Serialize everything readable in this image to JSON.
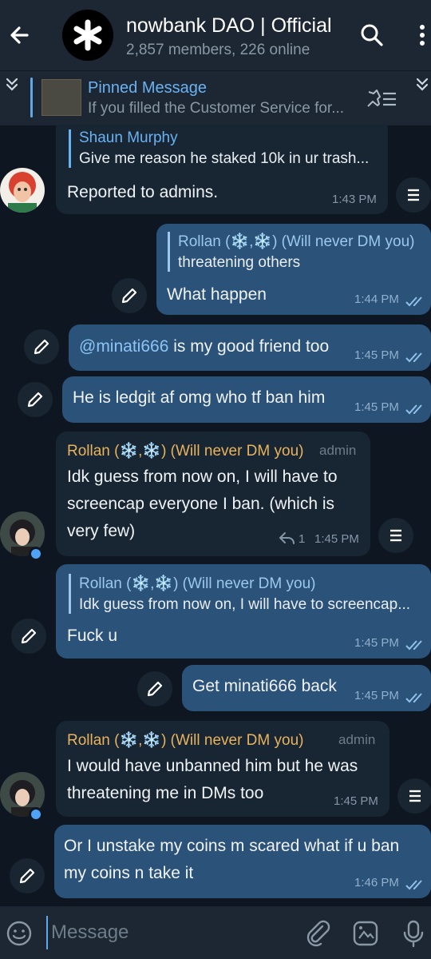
{
  "header": {
    "title": "nowbank DAO | Official",
    "subtitle": "2,857 members, 226 online"
  },
  "pinned": {
    "title": "Pinned Message",
    "text": "If you filled the Customer Service for..."
  },
  "messages": [
    {
      "reply_name": "Shaun Murphy",
      "reply_text": "Give me reason he staked 10k in ur trash...",
      "text": "Reported to admins.",
      "time": "1:43 PM"
    },
    {
      "reply_name": "Rollan (❄️,❄️) (Will never DM you)",
      "reply_text": "threatening others",
      "text": "What happen",
      "time": "1:44 PM"
    },
    {
      "mention": "@minati666",
      "text": " is my good friend too",
      "time": "1:45 PM"
    },
    {
      "text": "He is ledgit af omg who tf ban him",
      "time": "1:45 PM"
    },
    {
      "sender": "Rollan (❄️,❄️) (Will never DM you)",
      "role": "admin",
      "line1": "Idk guess from now on, I will have to",
      "line2": "screencap everyone I ban. (which is",
      "line3": "very few)",
      "reply_count": "1",
      "time": "1:45 PM"
    },
    {
      "reply_name": "Rollan (❄️,❄️) (Will never DM you)",
      "reply_text": "Idk guess from now on, I will have to screencap...",
      "text": "Fuck u",
      "time": "1:45 PM"
    },
    {
      "text": "Get minati666 back",
      "time": "1:45 PM"
    },
    {
      "sender": "Rollan (❄️,❄️) (Will never DM you)",
      "role": "admin",
      "line1": "I would have unbanned him but he was",
      "line2": "threatening me in DMs too",
      "time": "1:45 PM"
    },
    {
      "line1": "Or I unstake my coins m scared what if u ban",
      "line2": "my coins n take it",
      "time": "1:46 PM"
    }
  ],
  "input": {
    "placeholder": "Message"
  },
  "colors": {
    "incoming": "#182533",
    "outgoing": "#2b5278",
    "accent": "#6ab2f2",
    "admin_name": "#e8b35d",
    "background": "#0e1621"
  }
}
